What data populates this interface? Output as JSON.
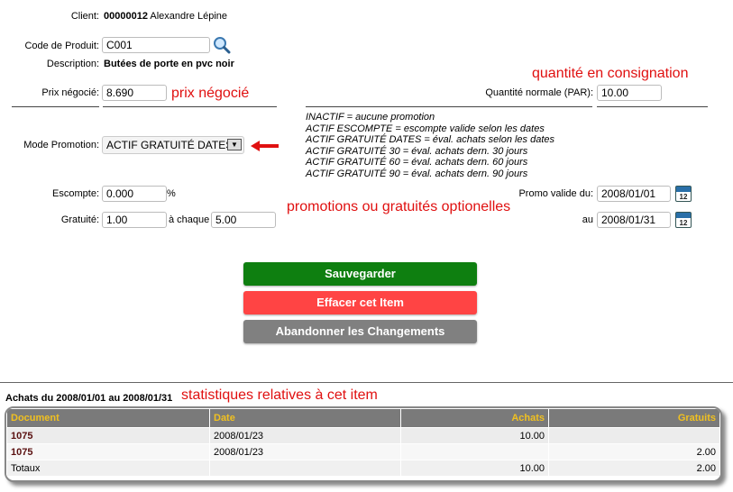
{
  "client": {
    "label": "Client:",
    "number": "00000012",
    "name": "Alexandre Lépine"
  },
  "product": {
    "label": "Code de Produit:",
    "code": "C001",
    "desc_label": "Description:",
    "description": "Butées de porte en pvc noir"
  },
  "price": {
    "label": "Prix négocié:",
    "value": "8.690",
    "annotation": "prix négocié"
  },
  "consign": {
    "annotation": "quantité en consignation",
    "label": "Quantité normale (PAR):",
    "value": "10.00"
  },
  "promo": {
    "label": "Mode Promotion:",
    "selected": "ACTIF GRATUITÉ DATES",
    "legend": [
      "INACTIF = aucune promotion",
      "ACTIF ESCOMPTE = escompte valide selon les dates",
      "ACTIF GRATUITÉ DATES = éval. achats selon les dates",
      "ACTIF GRATUITÉ 30 = éval. achats dern. 30 jours",
      "ACTIF GRATUITÉ 60 = éval. achats dern. 60 jours",
      "ACTIF GRATUITÉ 90 = éval. achats dern. 90 jours"
    ],
    "annotation": "promotions ou gratuités optionelles",
    "escompte_label": "Escompte:",
    "escompte_value": "0.000",
    "percent": "%",
    "gratuite_label": "Gratuité:",
    "gratuite_value": "1.00",
    "chaque_label": "à chaque",
    "chaque_value": "5.00",
    "valid_from_label": "Promo valide du:",
    "valid_from": "2008/01/01",
    "valid_to_label": "au",
    "valid_to": "2008/01/31",
    "calendar_day": "12"
  },
  "buttons": {
    "save": "Sauvegarder",
    "delete": "Effacer cet Item",
    "abandon": "Abandonner les Changements"
  },
  "stats": {
    "title": "Achats du 2008/01/01 au 2008/01/31",
    "annotation": "statistiques relatives à cet item",
    "headers": [
      "Document",
      "Date",
      "Achats",
      "Gratuits"
    ],
    "rows": [
      {
        "doc": "1075",
        "date": "2008/01/23",
        "achats": "10.00",
        "gratuits": ""
      },
      {
        "doc": "1075",
        "date": "2008/01/23",
        "achats": "",
        "gratuits": "2.00"
      }
    ],
    "total": {
      "label": "Totaux",
      "achats": "10.00",
      "gratuits": "2.00"
    }
  },
  "colors": {
    "save": "#0e7f10",
    "delete": "#ff4444",
    "abandon": "#808080",
    "annotation": "#e01010",
    "header_text": "#f0c020"
  },
  "icons": {
    "search": "magnifier-icon",
    "calendar": "calendar-icon",
    "arrow": "red-arrow-left-icon"
  }
}
